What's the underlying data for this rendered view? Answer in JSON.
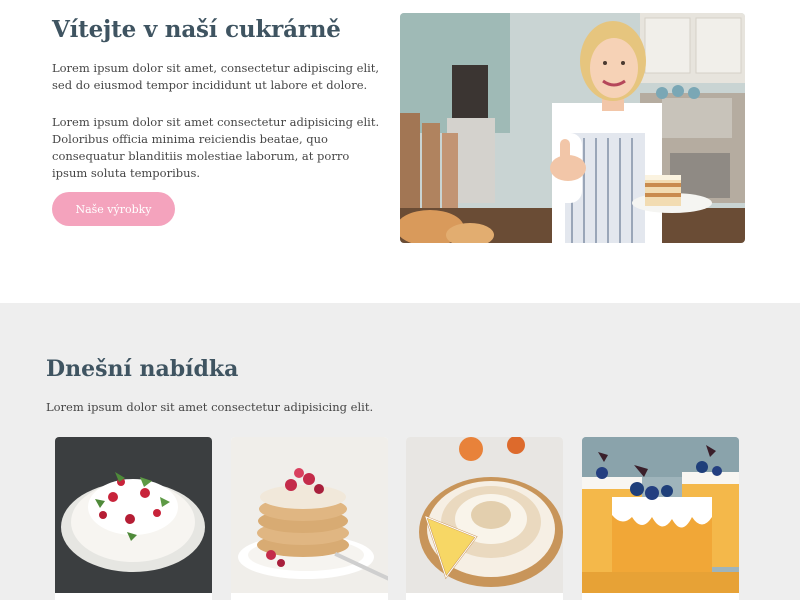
{
  "hero": {
    "title": "Vítejte v naší cukrárně",
    "paragraph_1": "Lorem ipsum dolor sit amet, consectetur adipiscing elit, sed do eiusmod tempor incididunt ut labore et dolore.",
    "paragraph_2": "Lorem ipsum dolor sit amet consectetur adipisicing elit. Doloribus officia minima reiciendis beatae, quo consequatur blanditiis molestiae laborum, at porro ipsum soluta temporibus.",
    "cta_label": "Naše výrobky"
  },
  "offer": {
    "title": "Dnešní nabídka",
    "lead": "Lorem ipsum dolor sit amet consectetur adipisicing elit."
  },
  "colors": {
    "accent": "#f4a3bd",
    "heading": "#3f5461",
    "section_bg": "#eeeeee"
  }
}
